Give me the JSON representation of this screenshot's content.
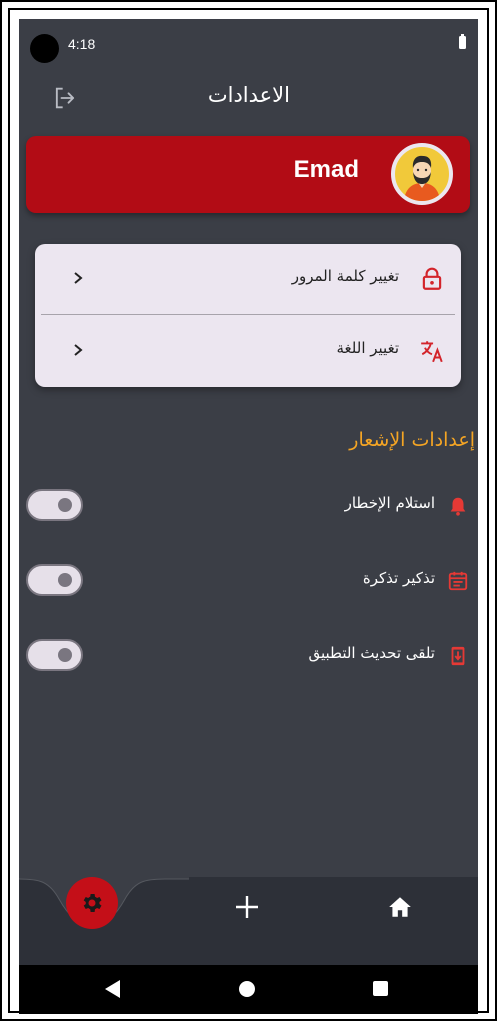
{
  "status_bar": {
    "time": "4:18"
  },
  "app_bar": {
    "title": "الاعدادات"
  },
  "profile": {
    "name": "Emad"
  },
  "account_options": [
    {
      "label": "تغيير كلمة المرور",
      "icon": "lock-icon"
    },
    {
      "label": "تغيير اللغة",
      "icon": "translate-icon"
    }
  ],
  "notifications": {
    "title": "إعدادات الإشعار",
    "items": [
      {
        "label": "استلام الإخطار",
        "icon": "bell-icon",
        "enabled": false
      },
      {
        "label": "تذكير تذكرة",
        "icon": "calendar-icon",
        "enabled": false
      },
      {
        "label": "تلقى تحديث التطبيق",
        "icon": "app-update-icon",
        "enabled": false
      }
    ]
  },
  "bottom_nav": {
    "items": [
      "gear-icon",
      "plus-icon",
      "home-icon"
    ],
    "active": "gear-icon"
  },
  "colors": {
    "background": "#3b3e46",
    "accent_red": "#b20c15",
    "section_title": "#f5a524",
    "card": "#ece6f0",
    "icon_red": "#e53935"
  }
}
